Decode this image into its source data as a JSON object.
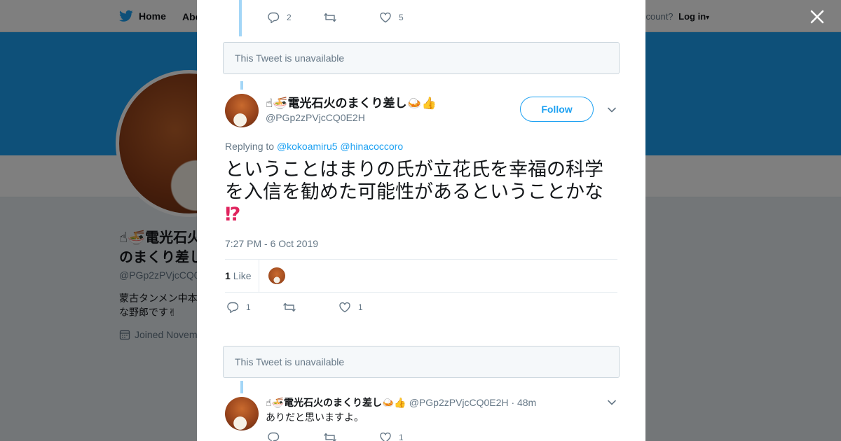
{
  "background": {
    "nav": {
      "home": "Home",
      "about": "Abo",
      "account_prompt": "ccount?",
      "login": "Log in"
    },
    "profile": {
      "name": "☝🍜電光石火のまくり差し🍛👍",
      "handle": "@PGp2zPVjcCQ0",
      "bio": "蒙古タンメン中本\nな野郎です✌",
      "joined": "Joined Novem"
    }
  },
  "modal": {
    "top_tweet_stats": {
      "replies": "2",
      "retweets": "",
      "likes": "5"
    },
    "unavailable_1": "This Tweet is unavailable",
    "main_tweet": {
      "name": "☝🍜電光石火のまくり差し🍛👍",
      "handle": "@PGp2zPVjcCQ0E2H",
      "follow_label": "Follow",
      "replying_label": "Replying to",
      "reply_to_1": "@kokoamiru5",
      "reply_to_2": "@hinacoccoro",
      "text": "ということはまりの氏が立花氏を幸福の科学を入信を勧めた可能性があるということかな",
      "text_emoji": "⁉",
      "timestamp": "7:27 PM - 6 Oct 2019",
      "likes_count": "1",
      "likes_label": "Like",
      "stats": {
        "replies": "1",
        "retweets": "",
        "likes": "1"
      }
    },
    "unavailable_2": "This Tweet is unavailable",
    "reply_tweet": {
      "name": "☝🍜電光石火のまくり差し🍛👍",
      "handle": "@PGp2zPVjcCQ0E2H",
      "time": "· 48m",
      "text": "ありだと思いますよ。",
      "stats": {
        "replies": "",
        "retweets": "",
        "likes": "1"
      }
    }
  },
  "colors": {
    "accent": "#1da1f2",
    "thread_line": "#a3d6f7",
    "muted": "#657786"
  }
}
